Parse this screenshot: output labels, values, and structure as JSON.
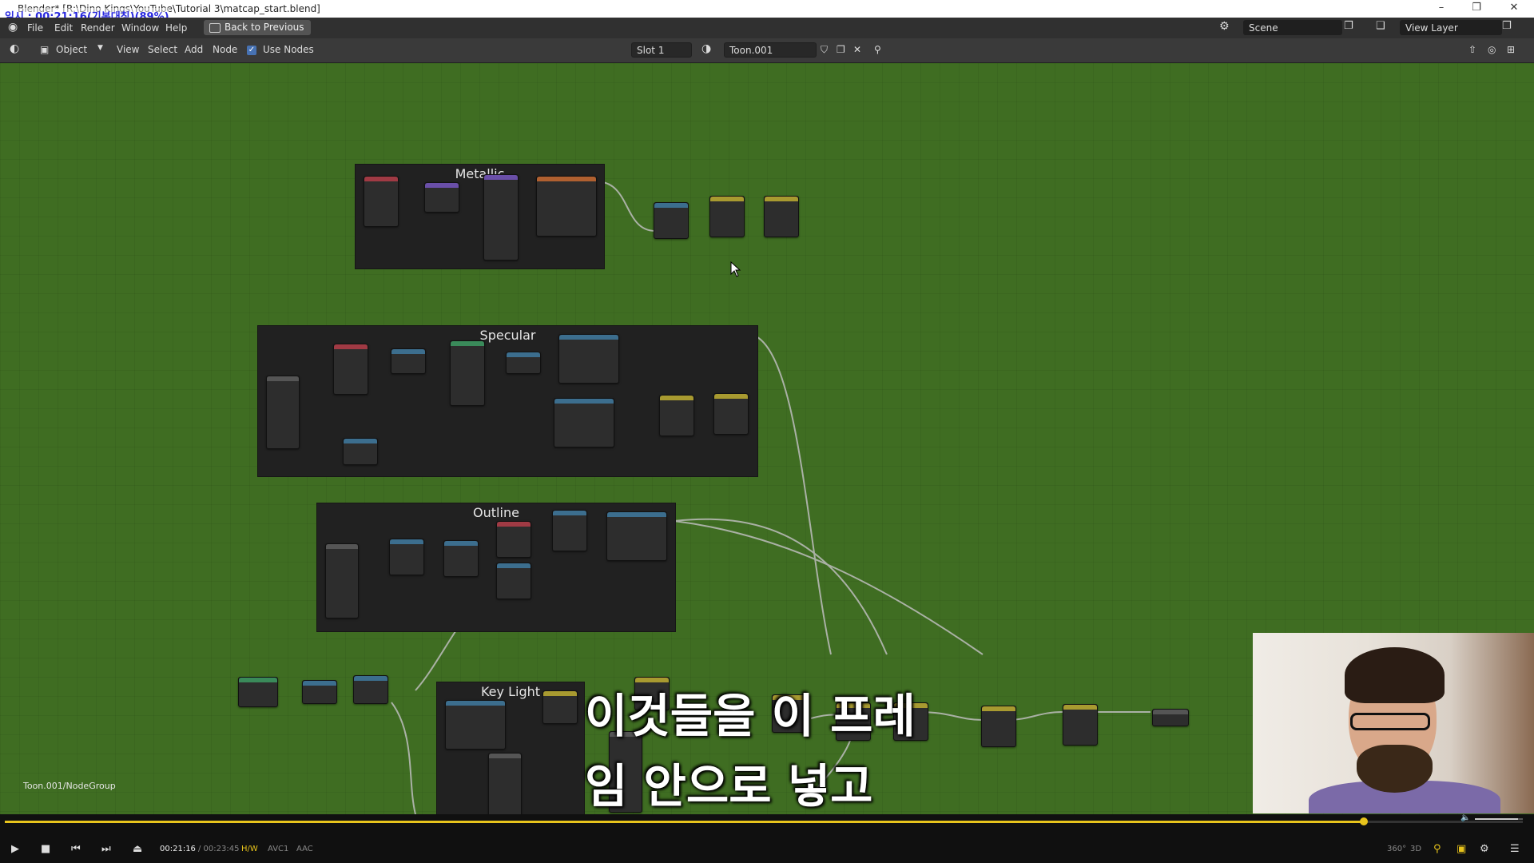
{
  "window": {
    "title": "Blender* [R:\\Dino Kings\\YouTube\\Tutorial 3\\matcap_start.blend]",
    "overlay": "일시 : 00:21:16(기본대칭)(89%)",
    "minimize": "–",
    "restore": "❐",
    "close": "✕"
  },
  "menu": {
    "items": [
      "File",
      "Edit",
      "Render",
      "Window",
      "Help"
    ],
    "back_label": "Back to Previous",
    "scene_label": "Scene",
    "view_layer_label": "View Layer"
  },
  "header": {
    "mode": "Object",
    "items": [
      "View",
      "Select",
      "Add",
      "Node"
    ],
    "use_nodes_label": "Use Nodes",
    "slot": "Slot 1",
    "material": "Toon.001"
  },
  "frames": {
    "metallic": "Metallic",
    "specular": "Specular",
    "outline": "Outline",
    "key_light": "Key Light"
  },
  "breadcrumb": "Toon.001/NodeGroup",
  "subtitle": [
    "이것들을 이 프레",
    "임 안으로 넣고"
  ],
  "player": {
    "time_current": "00:21:16",
    "time_total": "/ 00:23:45",
    "badge_hw": "H/W",
    "badge_video": "AVC1",
    "badge_audio": "AAC",
    "progress": 0.895,
    "volume": 0.9,
    "right_labels": [
      "360°",
      "3D"
    ]
  },
  "colors": {
    "editor_bg": "#3f6d22",
    "accent": "#e8c41c",
    "node_red": "#a03a44",
    "node_purple": "#6a4fa8",
    "node_blue": "#3c6e8e",
    "node_orange": "#b06030",
    "node_yellow": "#a89a30",
    "node_green": "#3a8a5a"
  }
}
